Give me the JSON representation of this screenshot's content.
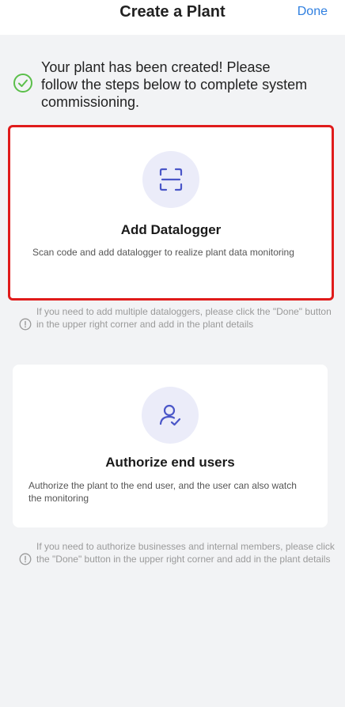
{
  "header": {
    "title": "Create a Plant",
    "done_label": "Done"
  },
  "success": {
    "icon": "check-circle-icon",
    "message": "Your plant has been created! Please follow the steps below to complete system commissioning."
  },
  "steps": [
    {
      "icon": "scan-icon",
      "title": "Add Datalogger",
      "description": "Scan code and add datalogger to realize plant data monitoring",
      "tip": "If you need to add multiple dataloggers, please click the \"Done\" button in the upper right corner and add in the plant details"
    },
    {
      "icon": "user-authorize-icon",
      "title": "Authorize end users",
      "description": "Authorize the plant to the end user, and the user can also watch the monitoring",
      "tip": "If you need to authorize businesses and internal members, please click the \"Done\" button in the upper right corner and add in the plant details"
    }
  ],
  "colors": {
    "accent": "#2f7fe0",
    "success": "#5bbf4a",
    "highlight_border": "#e01b1b",
    "icon_bg": "#ebecf9",
    "icon_stroke": "#4a56c8"
  }
}
